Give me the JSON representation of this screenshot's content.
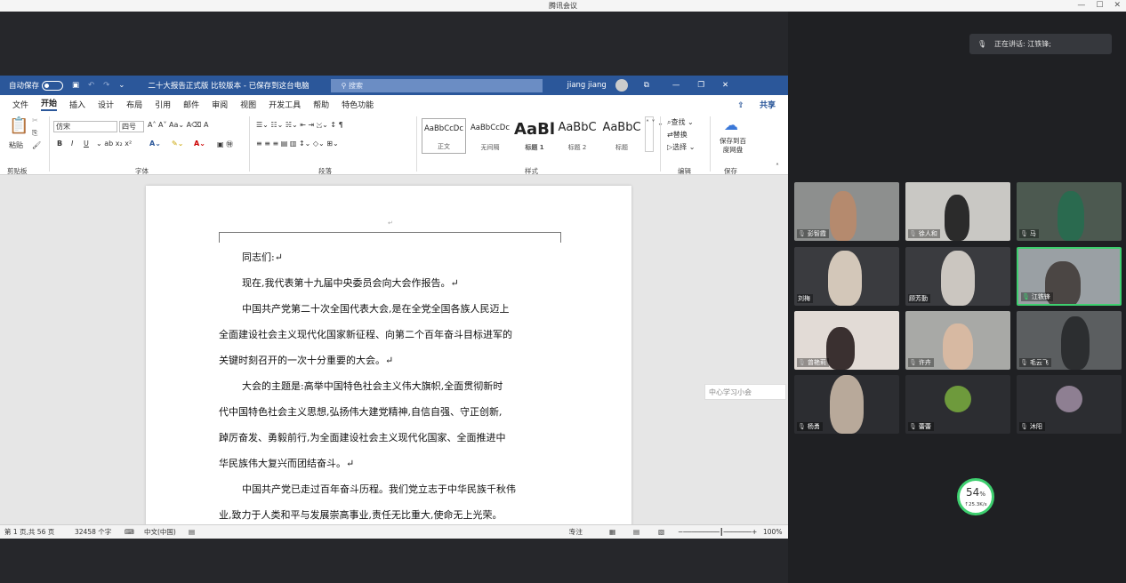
{
  "app_title": "腾讯会议",
  "window_controls": [
    "—",
    "☐",
    "✕"
  ],
  "speaker": {
    "label": "正在讲话: 江铁锋;"
  },
  "word": {
    "autosave_label": "自动保存",
    "autosave_state": "关",
    "doc_title": "二十大报告正式版 比较版本 - 已保存到这台电脑",
    "search_placeholder": "搜索",
    "user_name": "jiang jiang",
    "menu": [
      "文件",
      "开始",
      "插入",
      "设计",
      "布局",
      "引用",
      "邮件",
      "审阅",
      "视图",
      "开发工具",
      "帮助",
      "特色功能"
    ],
    "share_label": "共享",
    "font_name": "仿宋",
    "font_size": "四号",
    "groups": [
      "剪贴板",
      "字体",
      "段落",
      "样式",
      "编辑",
      "保存"
    ],
    "paste_label": "粘贴",
    "styles": [
      {
        "preview": "AaBbCcDc",
        "name": "正文"
      },
      {
        "preview": "AaBbCcDc",
        "name": "无间隔"
      },
      {
        "preview": "AaBl",
        "name": "标题 1"
      },
      {
        "preview": "AaBbC",
        "name": "标题 2"
      },
      {
        "preview": "AaBbC",
        "name": "标题"
      }
    ],
    "edit_items": [
      "查找",
      "替换",
      "选择"
    ],
    "save_baidu_label": "保存到百度网盘",
    "paragraphs": [
      "同志们:↵",
      "现在,我代表第十九届中央委员会向大会作报告。↵",
      "中国共产党第二十次全国代表大会,是在全党全国各族人民迈上",
      "全面建设社会主义现代化国家新征程、向第二个百年奋斗目标进军的",
      "关键时刻召开的一次十分重要的大会。↵",
      "大会的主题是:高举中国特色社会主义伟大旗帜,全面贯彻新时",
      "代中国特色社会主义思想,弘扬伟大建党精神,自信自强、守正创新,",
      "踔厉奋发、勇毅前行,为全面建设社会主义现代化国家、全面推进中",
      "华民族伟大复兴而团结奋斗。↵",
      "中国共产党已走过百年奋斗历程。我们党立志于中华民族千秋伟",
      "业,致力于人类和平与发展崇高事业,责任无比重大,使命无上光荣。"
    ],
    "status": {
      "page": "第 1 页,共 56 页",
      "words": "32458 个字",
      "lang": "中文(中国)",
      "focus": "专注",
      "zoom": "100%"
    }
  },
  "participants": [
    "彭智霞",
    "徐人和",
    "马",
    "刘梅",
    "顾芳勤",
    "江铁锋",
    "曾艳莉",
    "许卉",
    "毛云飞",
    "杨勇",
    "蕾蕾",
    "沐阳"
  ],
  "network": {
    "percent": "54",
    "unit": "%",
    "speed": "↑25.3K/s"
  },
  "watermark_text": "中心学习小会"
}
